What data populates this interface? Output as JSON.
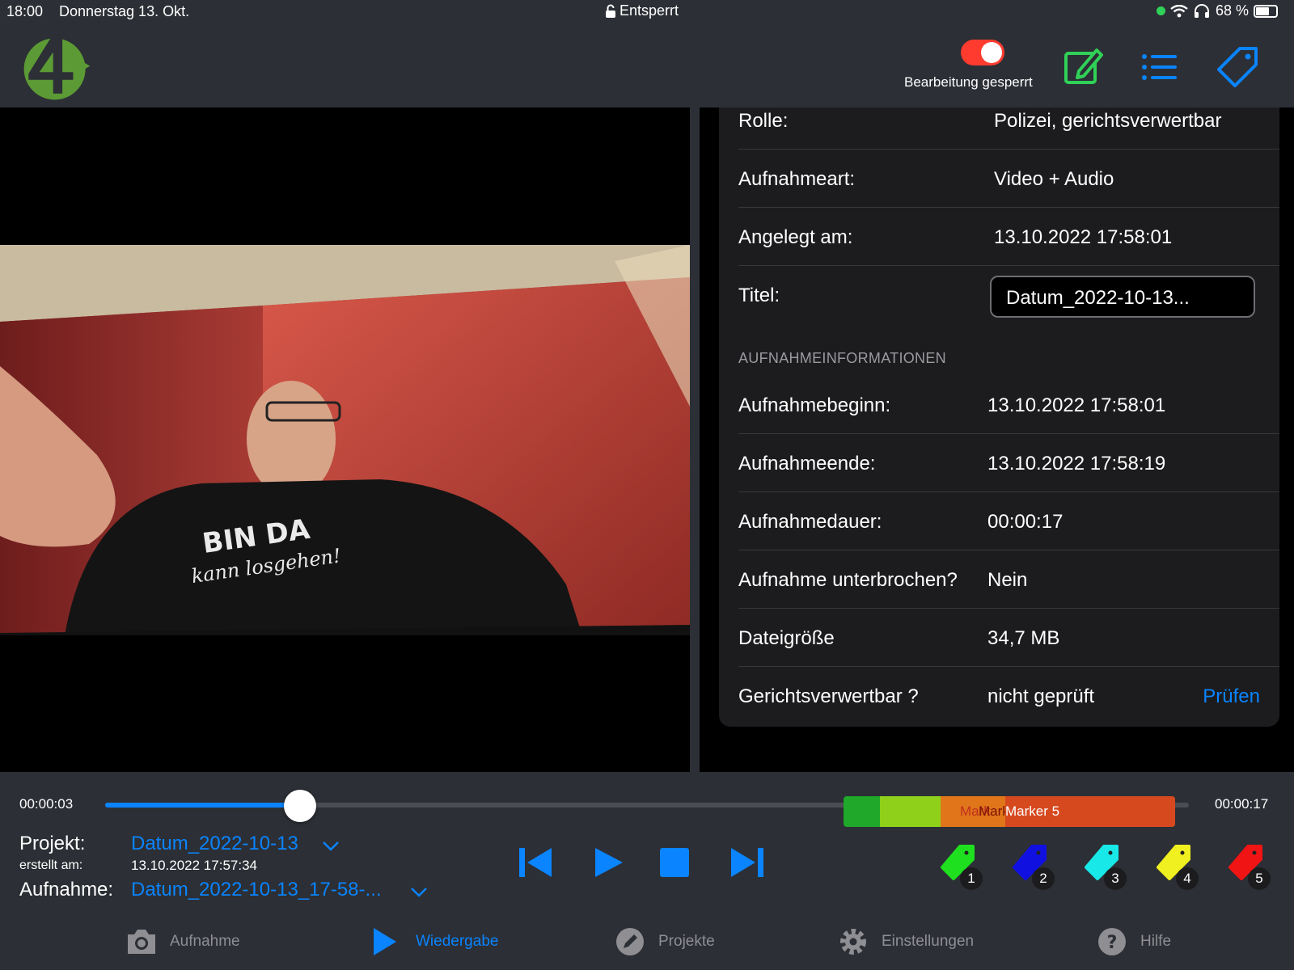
{
  "status_bar": {
    "time": "18:00",
    "date": "Donnerstag 13. Okt.",
    "lock_text": "Entsperrt",
    "battery": "68 %"
  },
  "header": {
    "toggle_label": "Bearbeitung gesperrt",
    "toggle_on": true,
    "toggle_color": "#ff3b30",
    "icons": [
      "edit-icon",
      "list-icon",
      "tag-icon"
    ]
  },
  "details": {
    "rows_top": [
      {
        "label": "Rolle:",
        "value": "Polizei, gerichtsverwertbar"
      },
      {
        "label": "Aufnahmeart:",
        "value": "Video + Audio"
      },
      {
        "label": "Angelegt am:",
        "value": "13.10.2022 17:58:01"
      }
    ],
    "title_label": "Titel:",
    "title_value": "Datum_2022-10-13...",
    "section_header": "AUFNAHMEINFORMATIONEN",
    "rows_info": [
      {
        "label": "Aufnahmebeginn:",
        "value": "13.10.2022 17:58:01"
      },
      {
        "label": "Aufnahmeende:",
        "value": "13.10.2022 17:58:19"
      },
      {
        "label": "Aufnahmedauer:",
        "value": "00:00:17"
      },
      {
        "label": "Aufnahme unterbrochen?",
        "value": "Nein"
      },
      {
        "label": "Dateigröße",
        "value": "34,7 MB"
      },
      {
        "label": "Gerichtsverwertbar ?",
        "value": "nicht geprüft",
        "action": "Prüfen"
      }
    ]
  },
  "playback": {
    "time_current": "00:00:03",
    "time_total": "00:00:17",
    "progress": 0.18,
    "markers": [
      {
        "label": "",
        "color": "#1fa82a"
      },
      {
        "label": "",
        "color": "#8fd11a"
      },
      {
        "label": "Mark",
        "color": "#e0751a"
      },
      {
        "label": "Mark",
        "color": "#e0751a"
      },
      {
        "label": "Marker 5",
        "color": "#d6491f"
      }
    ],
    "project_label": "Projekt:",
    "project_value": "Datum_2022-10-13",
    "created_label": "erstellt am:",
    "created_value": "13.10.2022 17:57:34",
    "recording_label": "Aufnahme:",
    "recording_value": "Datum_2022-10-13_17-58-...",
    "tags": [
      {
        "num": "1",
        "color": "#1ee01e"
      },
      {
        "num": "2",
        "color": "#1010e0"
      },
      {
        "num": "3",
        "color": "#19e8e8"
      },
      {
        "num": "4",
        "color": "#f0f020"
      },
      {
        "num": "5",
        "color": "#f01414"
      }
    ]
  },
  "tabbar": {
    "active": "Wiedergabe",
    "tabs": [
      {
        "label": "Aufnahme",
        "icon": "camera-icon"
      },
      {
        "label": "Wiedergabe",
        "icon": "play-icon"
      },
      {
        "label": "Projekte",
        "icon": "pencil-icon"
      },
      {
        "label": "Einstellungen",
        "icon": "gear-icon"
      },
      {
        "label": "Hilfe",
        "icon": "question-icon"
      }
    ]
  },
  "colors": {
    "accent": "#0a84ff",
    "background": "#2c2f35",
    "card": "#1c1c1e"
  }
}
